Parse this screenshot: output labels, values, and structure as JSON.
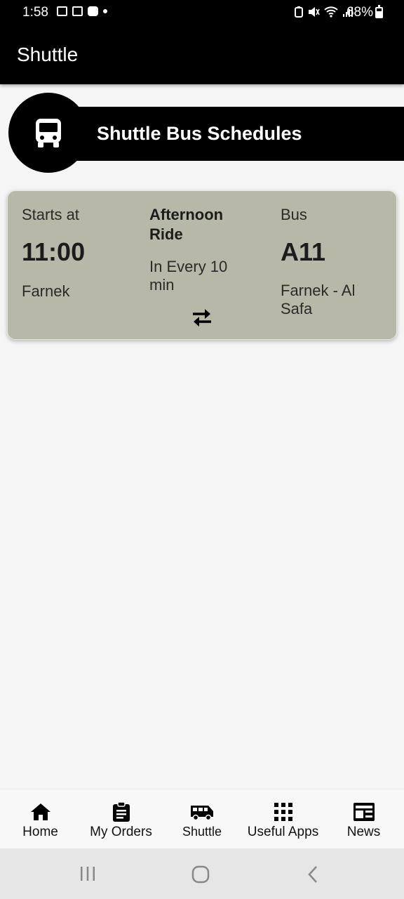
{
  "status_bar": {
    "time": "1:58",
    "battery": "68%",
    "icons": [
      "image-icon",
      "calendar-icon",
      "youtube-icon",
      "notification-dot-icon",
      "battery-saver-icon",
      "mute-icon",
      "wifi-icon",
      "signal-icon",
      "battery-icon"
    ]
  },
  "app_bar": {
    "title": "Shuttle"
  },
  "banner": {
    "title": "Shuttle Bus Schedules",
    "icon": "bus-icon"
  },
  "schedule": {
    "starts_label": "Starts at",
    "start_time": "11:00",
    "origin": "Farnek",
    "ride_name": "Afternoon Ride",
    "frequency": "In Every 10 min",
    "bus_label": "Bus",
    "bus_number": "A11",
    "route": "Farnek - Al Safa",
    "action_icon": "swap-icon"
  },
  "bottom_nav": {
    "items": [
      {
        "label": "Home",
        "icon": "home-icon"
      },
      {
        "label": "My Orders",
        "icon": "clipboard-icon"
      },
      {
        "label": "Shuttle",
        "icon": "shuttle-bus-icon"
      },
      {
        "label": "Useful Apps",
        "icon": "apps-grid-icon"
      },
      {
        "label": "News",
        "icon": "newspaper-icon"
      }
    ]
  },
  "system_nav": {
    "icons": [
      "recents-icon",
      "home-circle-icon",
      "back-icon"
    ]
  },
  "colors": {
    "bar": "#000000",
    "card": "#b8b8a9",
    "background": "#f5f5f5"
  }
}
